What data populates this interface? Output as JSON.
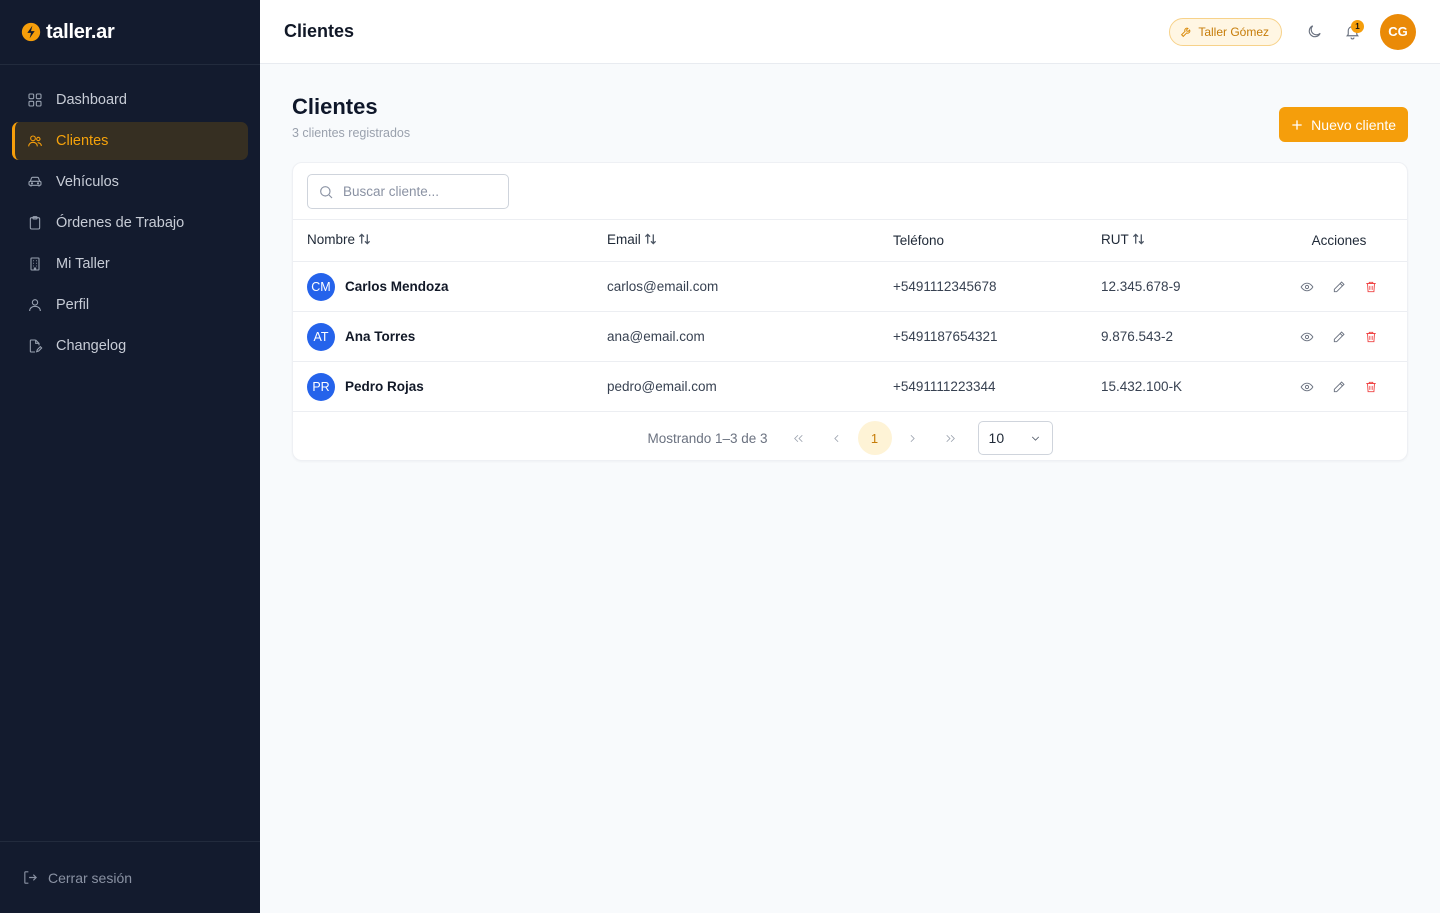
{
  "brand": {
    "name": "taller.ar",
    "accent": "#f59e0b"
  },
  "sidebar": {
    "items": [
      {
        "label": "Dashboard",
        "icon": "grid-icon",
        "active": false
      },
      {
        "label": "Clientes",
        "icon": "users-icon",
        "active": true
      },
      {
        "label": "Vehículos",
        "icon": "car-icon",
        "active": false
      },
      {
        "label": "Órdenes de Trabajo",
        "icon": "clipboard-icon",
        "active": false
      },
      {
        "label": "Mi Taller",
        "icon": "building-icon",
        "active": false
      },
      {
        "label": "Perfil",
        "icon": "user-icon",
        "active": false
      },
      {
        "label": "Changelog",
        "icon": "file-edit-icon",
        "active": false
      }
    ],
    "logout_label": "Cerrar sesión"
  },
  "topbar": {
    "title": "Clientes",
    "taller_chip": "Taller Gómez",
    "notifications_count": "1",
    "user_initials": "CG"
  },
  "main": {
    "title": "Clientes",
    "subtitle": "3 clientes registrados",
    "new_button": "Nuevo cliente",
    "search": {
      "placeholder": "Buscar cliente..."
    },
    "table": {
      "columns": [
        "Nombre",
        "Email",
        "Teléfono",
        "RUT",
        "Acciones"
      ],
      "rows": [
        {
          "initials": "CM",
          "name": "Carlos Mendoza",
          "email": "carlos@email.com",
          "phone": "+5491112345678",
          "rut": "12.345.678-9"
        },
        {
          "initials": "AT",
          "name": "Ana Torres",
          "email": "ana@email.com",
          "phone": "+5491187654321",
          "rut": "9.876.543-2"
        },
        {
          "initials": "PR",
          "name": "Pedro Rojas",
          "email": "pedro@email.com",
          "phone": "+5491111223344",
          "rut": "15.432.100-K"
        }
      ]
    },
    "pagination": {
      "summary": "Mostrando 1–3 de 3",
      "current_page": "1",
      "page_size": "10"
    }
  }
}
